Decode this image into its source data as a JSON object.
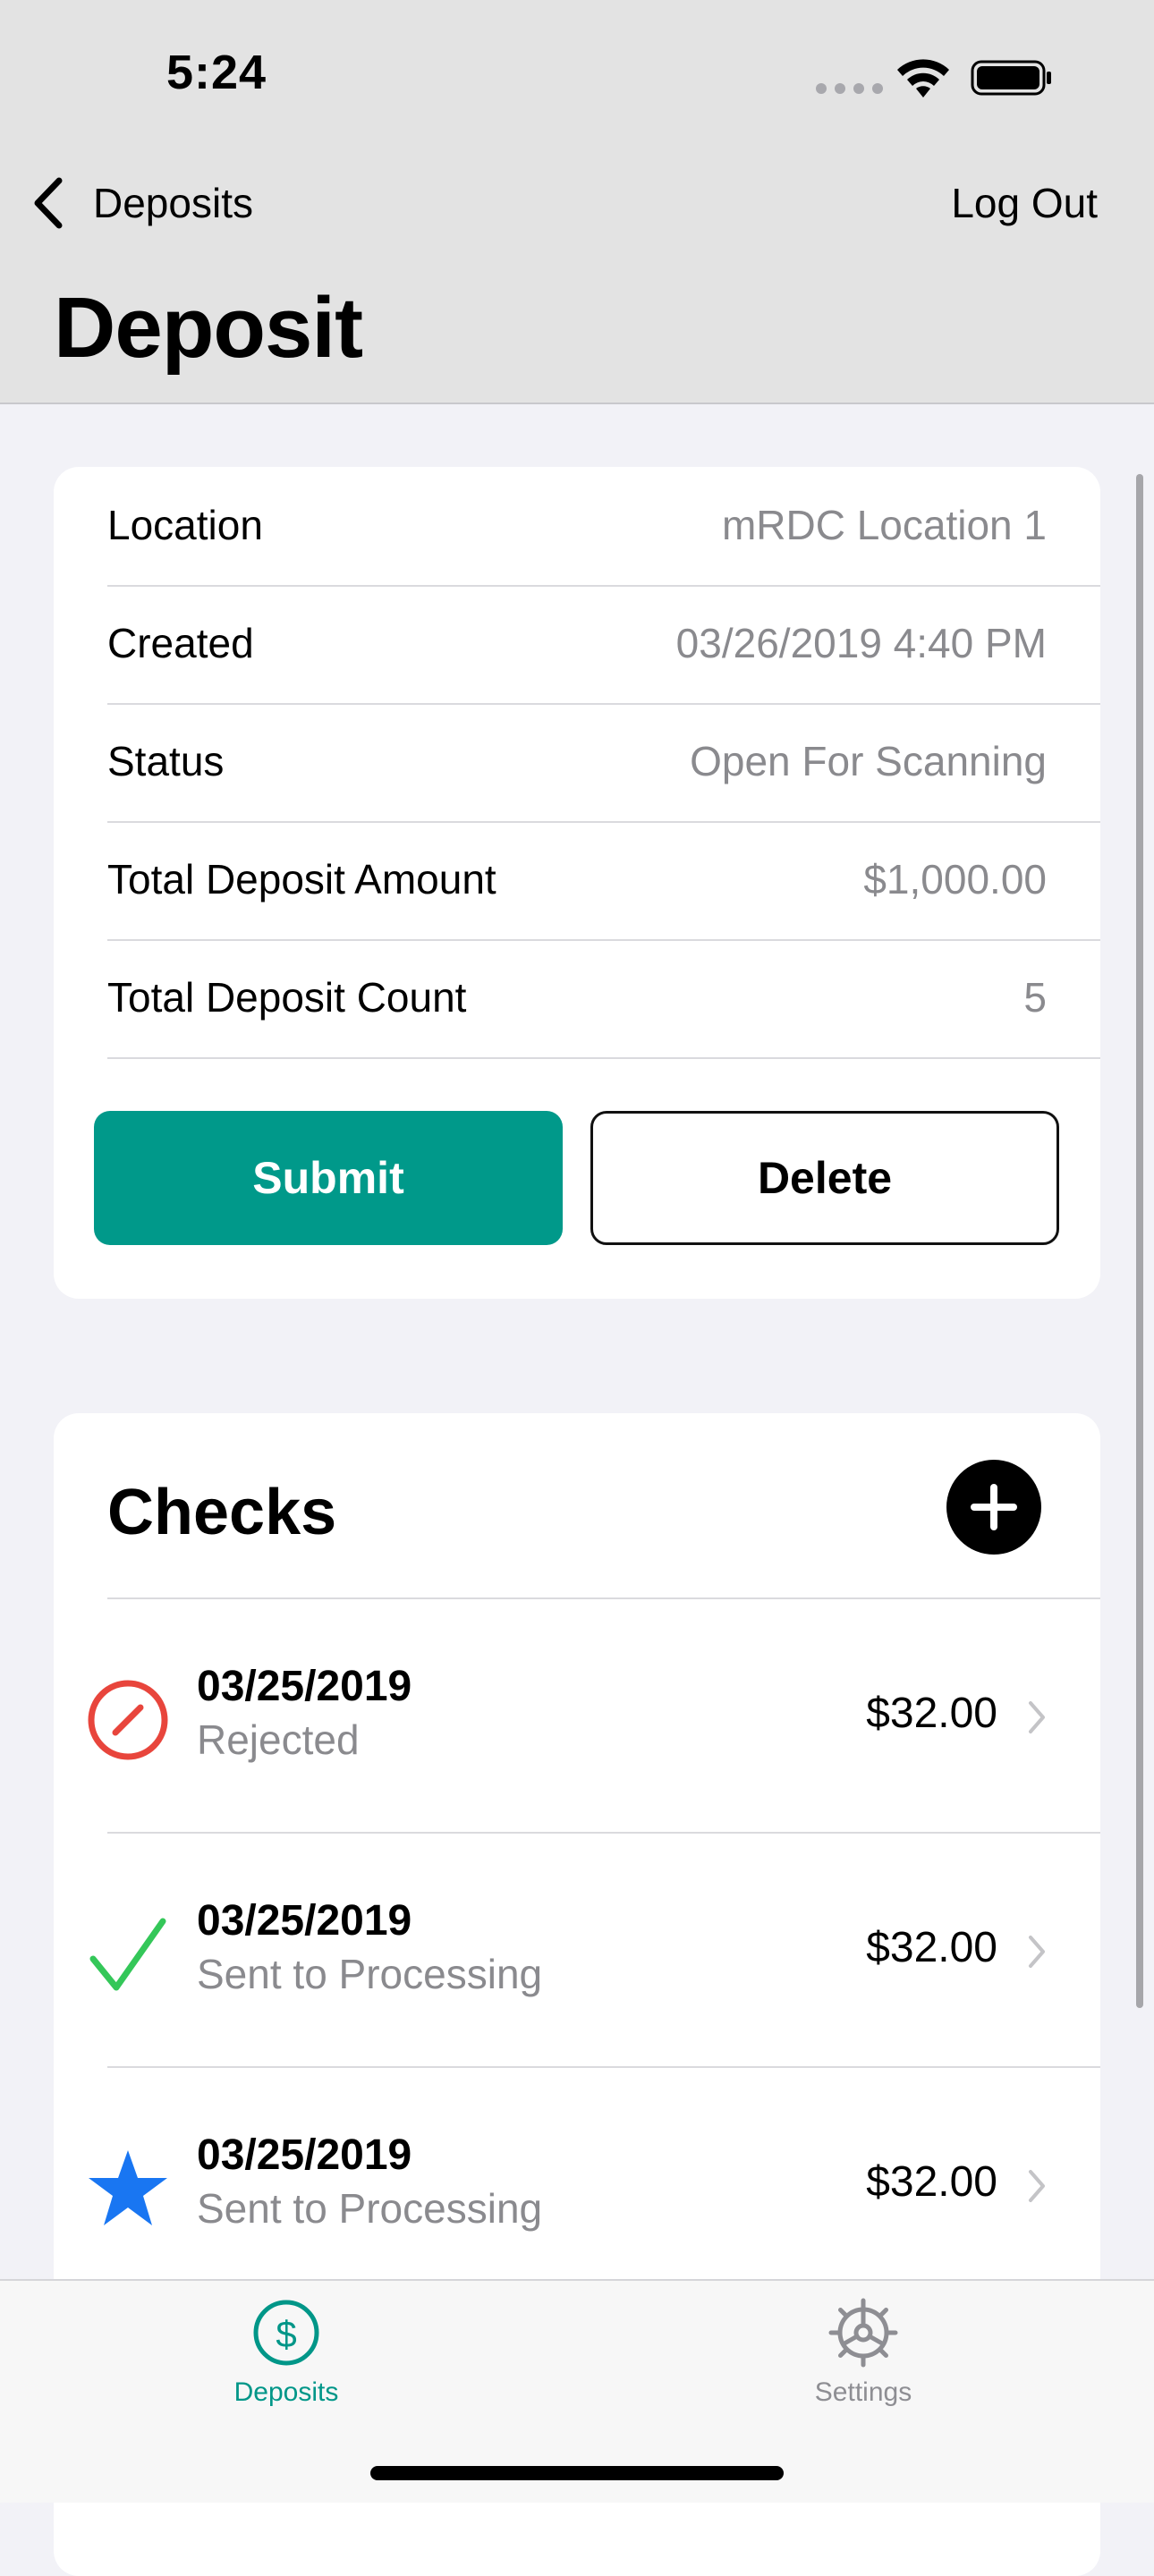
{
  "status_bar": {
    "time": "5:24"
  },
  "nav": {
    "back_label": "Deposits",
    "logout_label": "Log Out",
    "title": "Deposit"
  },
  "deposit": {
    "rows": [
      {
        "label": "Location",
        "value": "mRDC Location 1"
      },
      {
        "label": "Created",
        "value": "03/26/2019 4:40 PM"
      },
      {
        "label": "Status",
        "value": "Open For Scanning"
      },
      {
        "label": "Total Deposit Amount",
        "value": "$1,000.00"
      },
      {
        "label": "Total Deposit Count",
        "value": "5"
      }
    ],
    "submit_label": "Submit",
    "delete_label": "Delete"
  },
  "checks": {
    "title": "Checks",
    "items": [
      {
        "date": "03/25/2019",
        "status": "Rejected",
        "amount": "$32.00",
        "icon": "rejected-icon",
        "icon_color": "#E8453C"
      },
      {
        "date": "03/25/2019",
        "status": "Sent to Processing",
        "amount": "$32.00",
        "icon": "checkmark-icon",
        "icon_color": "#34C759"
      },
      {
        "date": "03/25/2019",
        "status": "Sent to Processing",
        "amount": "$32.00",
        "icon": "star-icon",
        "icon_color": "#1976F2"
      }
    ]
  },
  "tabbar": {
    "items": [
      {
        "label": "Deposits",
        "icon": "dollar-circle-icon",
        "selected": true
      },
      {
        "label": "Settings",
        "icon": "gear-icon",
        "selected": false
      }
    ]
  },
  "colors": {
    "accent": "#00998A",
    "tab_selected": "#009688",
    "background": "#F2F2F7"
  }
}
